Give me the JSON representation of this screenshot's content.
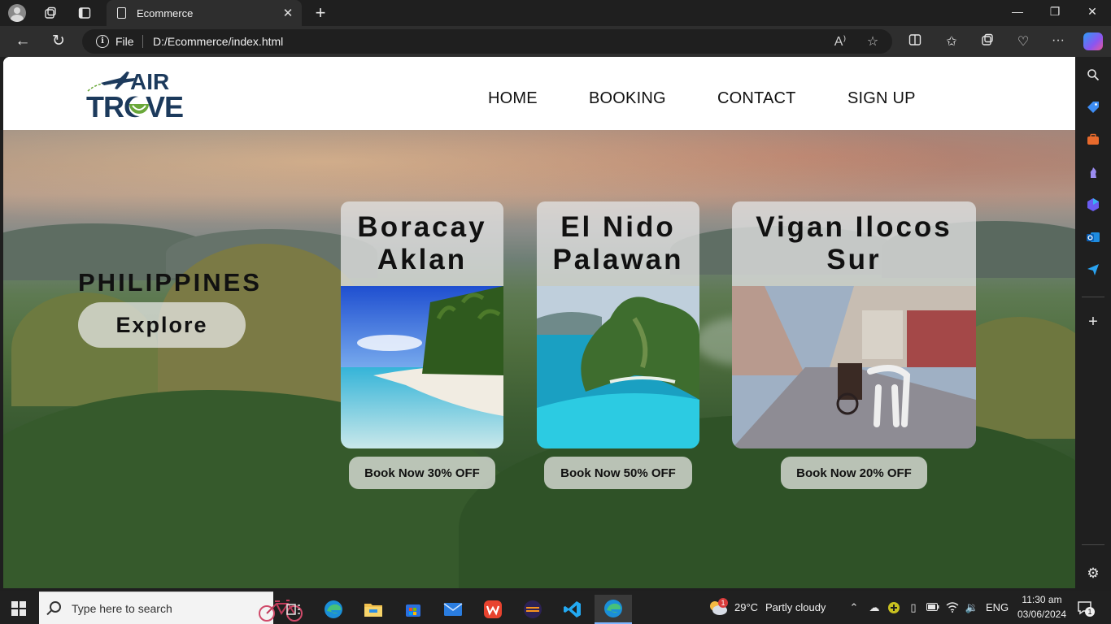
{
  "browser": {
    "tab_title": "Ecommerce",
    "url_scheme": "File",
    "url": "D:/Ecommerce/index.html",
    "read_aloud_label": "A⁾"
  },
  "site": {
    "logo_top": "AIR",
    "logo_bottom": "TROVE",
    "nav": [
      "HOME",
      "BOOKING",
      "CONTACT",
      "SIGN UP"
    ],
    "country": "PHILIPPINES",
    "explore_label": "Explore",
    "destinations": [
      {
        "title_line1": "Boracay",
        "title_line2": "Aklan",
        "book_label": "Book Now 30% OFF"
      },
      {
        "title_line1": "El Nido",
        "title_line2": "Palawan",
        "book_label": "Book Now 50% OFF"
      },
      {
        "title_line1": "Vigan Ilocos",
        "title_line2": "Sur",
        "book_label": "Book Now 20% OFF"
      }
    ]
  },
  "taskbar": {
    "search_placeholder": "Type here to search",
    "weather_temp": "29°C",
    "weather_desc": "Partly cloudy",
    "weather_badge": "1",
    "language": "ENG",
    "time": "11:30 am",
    "date": "03/06/2024",
    "notification_count": "1"
  },
  "colors": {
    "brand_navy": "#1c3a5c",
    "brand_green": "#6aa83a"
  }
}
